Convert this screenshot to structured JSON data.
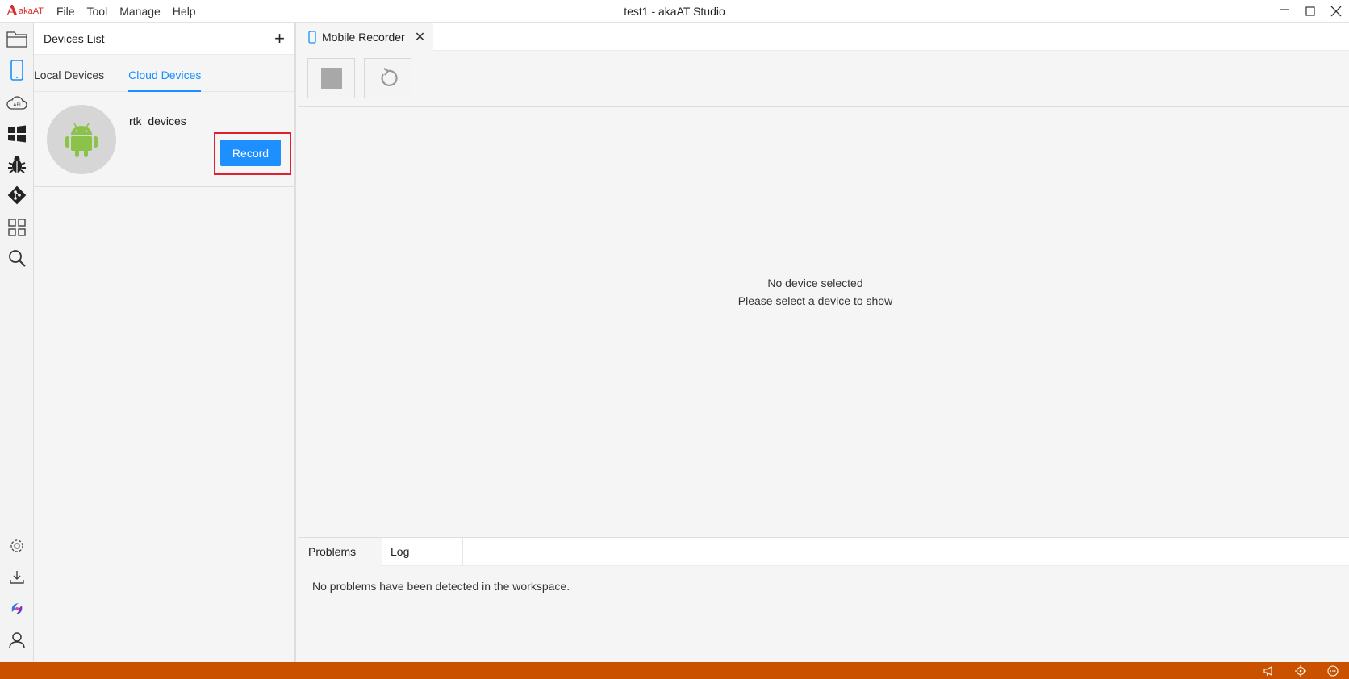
{
  "app": {
    "logo_text": "akaAT",
    "window_title": "test1 - akaAT Studio"
  },
  "menu": {
    "items": [
      "File",
      "Tool",
      "Manage",
      "Help"
    ]
  },
  "activity_bar": {
    "top_icons": [
      "explorer-icon",
      "mobile-device-icon",
      "api-cloud-icon",
      "windows-icon",
      "debug-bug-icon",
      "git-icon",
      "extensions-grid-icon",
      "search-icon"
    ],
    "bottom_icons": [
      "settings-gear-icon",
      "download-icon",
      "brand-swirl-icon",
      "account-icon"
    ],
    "active_index": 1
  },
  "devices_panel": {
    "title": "Devices List",
    "add_label": "+",
    "tabs": [
      {
        "label": "Local Devices",
        "active": false
      },
      {
        "label": "Cloud Devices",
        "active": true
      }
    ],
    "devices": [
      {
        "name": "rtk_devices",
        "icon": "android-icon",
        "action_label": "Record"
      }
    ]
  },
  "editor": {
    "tab_label": "Mobile Recorder",
    "tab_icon": "mobile-device-icon",
    "close_symbol": "✕",
    "toolbar": [
      "stop-icon",
      "refresh-icon"
    ],
    "empty_title": "No device selected",
    "empty_subtitle": "Please select a device to show"
  },
  "bottom_panel": {
    "tabs": [
      {
        "label": "Problems",
        "active": true
      },
      {
        "label": "Log",
        "active": false
      }
    ],
    "message": "No problems have been detected in the workspace."
  },
  "status_bar": {
    "color": "#c95100",
    "icons": [
      "broadcast-icon",
      "target-icon",
      "chat-icon"
    ]
  },
  "colors": {
    "accent": "#1890ff",
    "record_button": "#1e8fff",
    "highlight_frame": "#e0202f",
    "logo": "#d32f2f"
  }
}
